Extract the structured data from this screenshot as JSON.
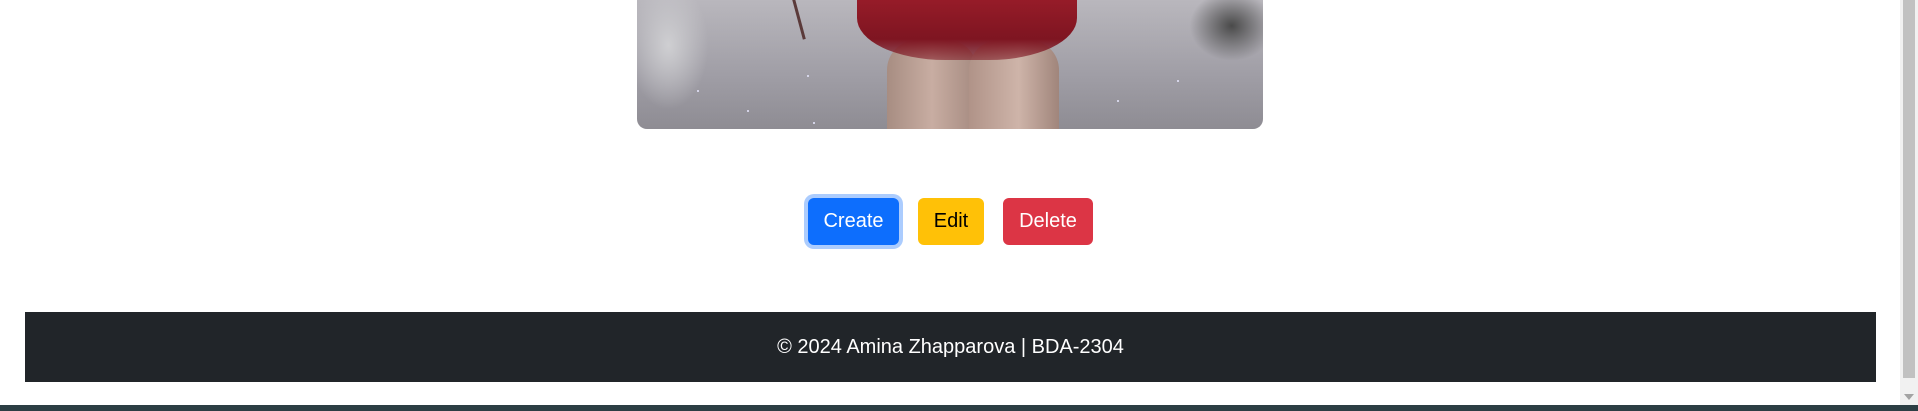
{
  "photo": {
    "description_name": "gallery-photo"
  },
  "buttons": {
    "create_label": "Create",
    "edit_label": "Edit",
    "delete_label": "Delete",
    "create_color": "#0d6efd",
    "edit_color": "#ffc107",
    "delete_color": "#dc3545"
  },
  "footer": {
    "text": "© 2024 Amina Zhapparova | BDA-2304",
    "background": "#212529"
  }
}
